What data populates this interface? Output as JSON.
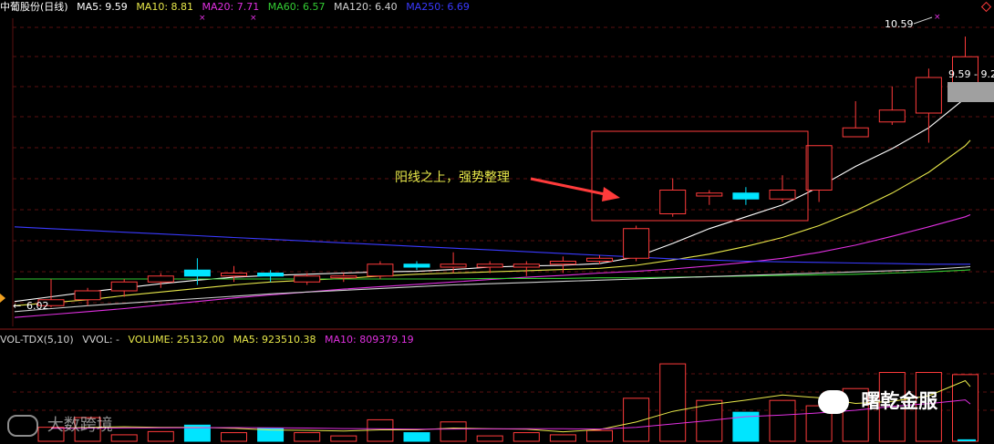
{
  "header": {
    "stock_name": "中葡股份(日线)",
    "ma_labels": [
      {
        "text": "MA5: 9.59",
        "color": "#ffffff"
      },
      {
        "text": "MA10: 8.81",
        "color": "#e8e84a"
      },
      {
        "text": "MA20: 7.71",
        "color": "#e030e0"
      },
      {
        "text": "MA60: 6.57",
        "color": "#33cc33"
      },
      {
        "text": "MA120: 6.40",
        "color": "#d0d0d0"
      },
      {
        "text": "MA250: 6.69",
        "color": "#3a3aff"
      }
    ]
  },
  "volume_header": {
    "name": "VOL-TDX(5,10)",
    "vvol": "VVOL: -",
    "volume": "VOLUME: 25132.00",
    "ma5": "MA5: 923510.38",
    "ma10": "MA10: 809379.19"
  },
  "annotation": {
    "text": "阳线之上，强势整理",
    "color": "#e8e84a"
  },
  "watermarks": {
    "left": "大数跨境",
    "right": "曙乾金服"
  },
  "chart_data": {
    "type": "candlestick",
    "price_labels": {
      "high": "10.59",
      "low": "6.02",
      "last_ma5_range": "9.59 - 9.2"
    },
    "candles": [
      {
        "open": 6.05,
        "close": 6.15,
        "high": 6.5,
        "low": 6.02,
        "color": "#ff3b3b"
      },
      {
        "open": 6.15,
        "close": 6.3,
        "high": 6.35,
        "low": 6.05,
        "color": "#ff3b3b"
      },
      {
        "open": 6.3,
        "close": 6.45,
        "high": 6.5,
        "low": 6.2,
        "color": "#ff3b3b"
      },
      {
        "open": 6.45,
        "close": 6.55,
        "high": 6.6,
        "low": 6.35,
        "color": "#ff3b3b"
      },
      {
        "open": 6.65,
        "close": 6.55,
        "high": 6.85,
        "low": 6.4,
        "color": "#00e5ff"
      },
      {
        "open": 6.55,
        "close": 6.6,
        "high": 6.72,
        "low": 6.45,
        "color": "#ff3b3b"
      },
      {
        "open": 6.6,
        "close": 6.55,
        "high": 6.65,
        "low": 6.45,
        "color": "#00e5ff"
      },
      {
        "open": 6.45,
        "close": 6.55,
        "high": 6.6,
        "low": 6.4,
        "color": "#ff3b3b"
      },
      {
        "open": 6.55,
        "close": 6.55,
        "high": 6.6,
        "low": 6.45,
        "color": "#ff3b3b"
      },
      {
        "open": 6.55,
        "close": 6.75,
        "high": 6.8,
        "low": 6.5,
        "color": "#ff3b3b"
      },
      {
        "open": 6.75,
        "close": 6.7,
        "high": 6.8,
        "low": 6.65,
        "color": "#00e5ff"
      },
      {
        "open": 6.7,
        "close": 6.75,
        "high": 6.95,
        "low": 6.6,
        "color": "#ff3b3b"
      },
      {
        "open": 6.7,
        "close": 6.75,
        "high": 6.8,
        "low": 6.6,
        "color": "#ff3b3b"
      },
      {
        "open": 6.7,
        "close": 6.75,
        "high": 6.8,
        "low": 6.55,
        "color": "#ff3b3b"
      },
      {
        "open": 6.75,
        "close": 6.8,
        "high": 6.88,
        "low": 6.6,
        "color": "#ff3b3b"
      },
      {
        "open": 6.8,
        "close": 6.85,
        "high": 6.9,
        "low": 6.75,
        "color": "#ff3b3b"
      },
      {
        "open": 6.85,
        "close": 7.35,
        "high": 7.4,
        "low": 6.8,
        "color": "#ff3b3b"
      },
      {
        "open": 7.6,
        "close": 8.0,
        "high": 8.2,
        "low": 7.55,
        "color": "#ff3b3b"
      },
      {
        "open": 7.9,
        "close": 7.95,
        "high": 8.0,
        "low": 7.75,
        "color": "#ff3b3b"
      },
      {
        "open": 7.95,
        "close": 7.85,
        "high": 8.05,
        "low": 7.75,
        "color": "#00e5ff"
      },
      {
        "open": 7.85,
        "close": 8.0,
        "high": 8.25,
        "low": 7.8,
        "color": "#ff3b3b"
      },
      {
        "open": 8.0,
        "close": 8.75,
        "high": 8.75,
        "low": 7.8,
        "color": "#ff3b3b"
      },
      {
        "open": 8.9,
        "close": 9.05,
        "high": 9.5,
        "low": 8.9,
        "color": "#ff3b3b"
      },
      {
        "open": 9.15,
        "close": 9.35,
        "high": 9.75,
        "low": 9.1,
        "color": "#ff3b3b"
      },
      {
        "open": 9.3,
        "close": 9.9,
        "high": 10.05,
        "low": 8.8,
        "color": "#ff3b3b"
      },
      {
        "open": 9.7,
        "close": 10.25,
        "high": 10.59,
        "low": 9.5,
        "color": "#ff3b3b"
      }
    ],
    "ma_lines": [
      {
        "name": "MA5",
        "color": "#ffffff",
        "values": [
          6.2,
          6.28,
          6.35,
          6.42,
          6.48,
          6.53,
          6.56,
          6.58,
          6.6,
          6.62,
          6.63,
          6.66,
          6.7,
          6.72,
          6.73,
          6.76,
          6.87,
          7.1,
          7.35,
          7.55,
          7.75,
          8.05,
          8.4,
          8.7,
          9.05,
          9.55
        ]
      },
      {
        "name": "MA10",
        "color": "#e8e84a",
        "values": [
          6.1,
          6.15,
          6.22,
          6.28,
          6.34,
          6.4,
          6.45,
          6.48,
          6.51,
          6.55,
          6.58,
          6.6,
          6.62,
          6.64,
          6.66,
          6.68,
          6.73,
          6.82,
          6.92,
          7.05,
          7.2,
          7.4,
          7.65,
          7.95,
          8.3,
          8.75
        ]
      },
      {
        "name": "MA20",
        "color": "#e030e0",
        "values": [
          5.9,
          5.95,
          6.0,
          6.06,
          6.12,
          6.18,
          6.23,
          6.28,
          6.33,
          6.37,
          6.41,
          6.45,
          6.49,
          6.53,
          6.56,
          6.6,
          6.63,
          6.67,
          6.72,
          6.78,
          6.85,
          6.95,
          7.07,
          7.22,
          7.38,
          7.55
        ]
      },
      {
        "name": "MA60",
        "color": "#33cc33",
        "values": [
          6.5,
          6.5,
          6.5,
          6.5,
          6.5,
          6.5,
          6.5,
          6.5,
          6.5,
          6.5,
          6.5,
          6.5,
          6.51,
          6.51,
          6.51,
          6.52,
          6.52,
          6.53,
          6.54,
          6.55,
          6.56,
          6.57,
          6.58,
          6.6,
          6.62,
          6.65
        ]
      },
      {
        "name": "MA120",
        "color": "#d0d0d0",
        "values": [
          6.0,
          6.05,
          6.09,
          6.13,
          6.17,
          6.21,
          6.25,
          6.28,
          6.31,
          6.34,
          6.37,
          6.4,
          6.42,
          6.44,
          6.46,
          6.48,
          6.5,
          6.52,
          6.54,
          6.56,
          6.58,
          6.6,
          6.62,
          6.64,
          6.66,
          6.7
        ]
      },
      {
        "name": "MA250",
        "color": "#3a3aff",
        "values": [
          7.35,
          7.32,
          7.29,
          7.26,
          7.23,
          7.2,
          7.17,
          7.14,
          7.11,
          7.08,
          7.05,
          7.02,
          6.99,
          6.96,
          6.93,
          6.9,
          6.87,
          6.84,
          6.82,
          6.8,
          6.79,
          6.78,
          6.77,
          6.76,
          6.75,
          6.75
        ]
      }
    ],
    "volume": {
      "values": [
        13000,
        22000,
        6000,
        9000,
        15000,
        8000,
        12000,
        8000,
        5000,
        20000,
        8000,
        18000,
        5000,
        8000,
        6000,
        10000,
        40000,
        72000,
        38000,
        27000,
        38000,
        33000,
        49000,
        64000,
        64000,
        62000
      ],
      "ma5": [
        12000,
        13000,
        13500,
        13000,
        13000,
        12000,
        10500,
        10200,
        9500,
        10600,
        10600,
        12300,
        11700,
        11200,
        8800,
        10900,
        17900,
        27800,
        33900,
        38200,
        43000,
        40400,
        35200,
        37100,
        42300,
        56400
      ],
      "ma10": [
        12000,
        12200,
        12400,
        12500,
        12600,
        12700,
        12500,
        12300,
        11800,
        11500,
        11200,
        11400,
        11500,
        11700,
        11600,
        11400,
        13000,
        16100,
        19300,
        22900,
        24300,
        26400,
        28800,
        32500,
        35000,
        38500
      ],
      "max": 78000
    }
  }
}
